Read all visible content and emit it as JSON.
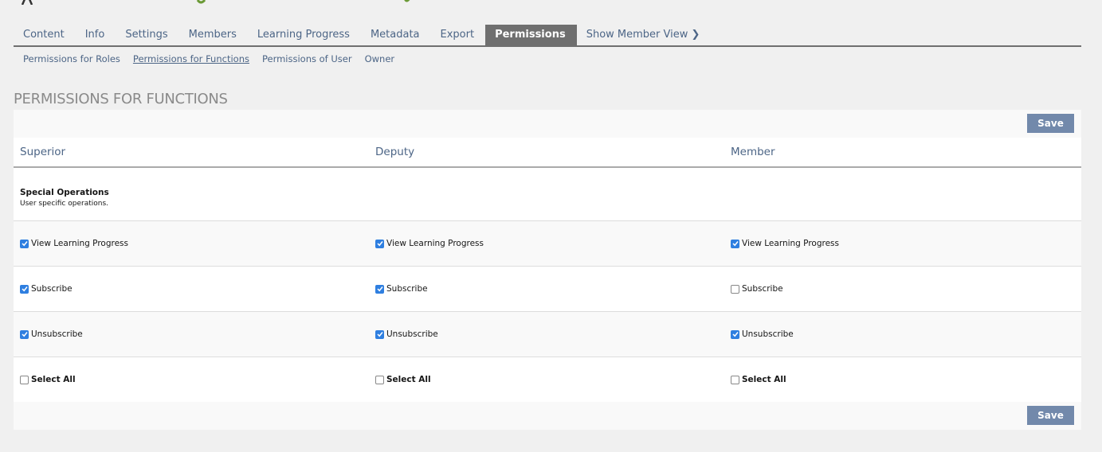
{
  "tabs": [
    "Content",
    "Info",
    "Settings",
    "Members",
    "Learning Progress",
    "Metadata",
    "Export",
    "Permissions",
    "Show Member View"
  ],
  "active_tab": "Permissions",
  "subtabs": [
    "Permissions for Roles",
    "Permissions for Functions",
    "Permissions of User",
    "Owner"
  ],
  "heading": "PERMISSIONS FOR FUNCTIONS",
  "save_label": "Save",
  "columns": [
    "Superior",
    "Deputy",
    "Member"
  ],
  "section": {
    "title": "Special Operations",
    "description": "User specific operations."
  },
  "rows": [
    {
      "label": "View Learning Progress",
      "checked": [
        true,
        true,
        true
      ]
    },
    {
      "label": "Subscribe",
      "checked": [
        true,
        true,
        false
      ]
    },
    {
      "label": "Unsubscribe",
      "checked": [
        true,
        true,
        true
      ]
    }
  ],
  "select_all": "Select All",
  "colors": {
    "accent": "#7289ab",
    "checkbox": "#2f7fe0",
    "link": "#4c6586"
  }
}
